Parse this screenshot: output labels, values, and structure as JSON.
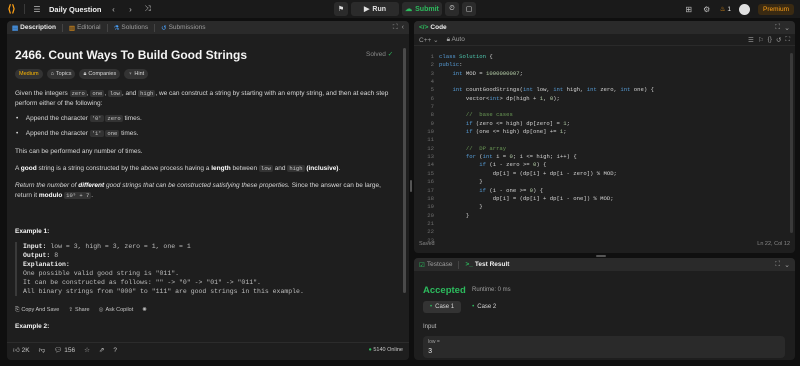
{
  "topbar": {
    "title": "Daily Question",
    "run_label": "Run",
    "submit_label": "Submit",
    "streak_count": "1",
    "premium_label": "Premium"
  },
  "description_panel": {
    "tabs": [
      {
        "label": "Description"
      },
      {
        "label": "Editorial"
      },
      {
        "label": "Solutions"
      },
      {
        "label": "Submissions"
      }
    ],
    "problem_title": "2466. Count Ways To Build Good Strings",
    "status": "Solved",
    "chips": {
      "difficulty": "Medium",
      "topics": "Topics",
      "companies": "Companies",
      "hint": "Hint"
    },
    "intro_1": "Given the integers",
    "intro_code_zero": "zero",
    "intro_code_one": "one",
    "intro_code_low": "low",
    "intro_2": ", and",
    "intro_code_high": "high",
    "intro_3": ", we can construct a string by starting with an empty string, and then at each step perform either of the following:",
    "bullet_1_pre": "Append the character",
    "bullet_1_char": "'0'",
    "bullet_1_var": "zero",
    "bullet_1_post": "times.",
    "bullet_2_pre": "Append the character",
    "bullet_2_char": "'1'",
    "bullet_2_var": "one",
    "bullet_2_post": "times.",
    "any_number": "This can be performed any number of times.",
    "good_1": "A",
    "good_word": "good",
    "good_2": "string is a string constructed by the above process having a",
    "good_length": "length",
    "good_3": "between",
    "good_low": "low",
    "good_and": "and",
    "good_high": "high",
    "good_incl": "(inclusive)",
    "return_1": "Return",
    "return_italic": "the number of",
    "return_different": "different",
    "return_2": "good strings that can be constructed satisfying these properties.",
    "return_3": "Since the answer can be large, return it",
    "return_modulo": "modulo",
    "return_mod_val": "10⁹ + 7",
    "example_1_title": "Example 1:",
    "example_1": {
      "input_label": "Input:",
      "input_value": "low = 3, high = 3, zero = 1, one = 1",
      "output_label": "Output:",
      "output_value": "8",
      "expl_label": "Explanation:",
      "expl_1": "One possible valid good string is \"011\".",
      "expl_2": "It can be constructed as follows: \"\" -> \"0\" -> \"01\" -> \"011\".",
      "expl_3": "All binary strings from \"000\" to \"111\" are good strings in this example."
    },
    "actions": {
      "copy": "Copy And Save",
      "share": "Share",
      "copilot": "Ask Copilot"
    },
    "example_2_title": "Example 2:",
    "footer": {
      "likes": "2K",
      "comments": "156",
      "online": "5140 Online"
    }
  },
  "code_panel": {
    "tab_label": "Code",
    "language": "C++",
    "auto_label": "Auto",
    "saved_label": "Saved",
    "cursor_pos": "Ln 22, Col 12",
    "line_numbers": [
      "1",
      "2",
      "3",
      "4",
      "5",
      "6",
      "7",
      "8",
      "9",
      "10",
      "11",
      "12",
      "13",
      "14",
      "15",
      "16",
      "17",
      "18",
      "19",
      "20",
      "21",
      "22",
      "23"
    ]
  },
  "result_panel": {
    "tab_testcase": "Testcase",
    "tab_result": "Test Result",
    "verdict": "Accepted",
    "runtime": "Runtime: 0 ms",
    "case_1": "Case 1",
    "case_2": "Case 2",
    "input_label": "Input",
    "var_name": "low =",
    "var_value": "3"
  },
  "colors": {
    "accent": "#ffa116",
    "success": "#2cbb5d",
    "medium": "#ffb800"
  }
}
